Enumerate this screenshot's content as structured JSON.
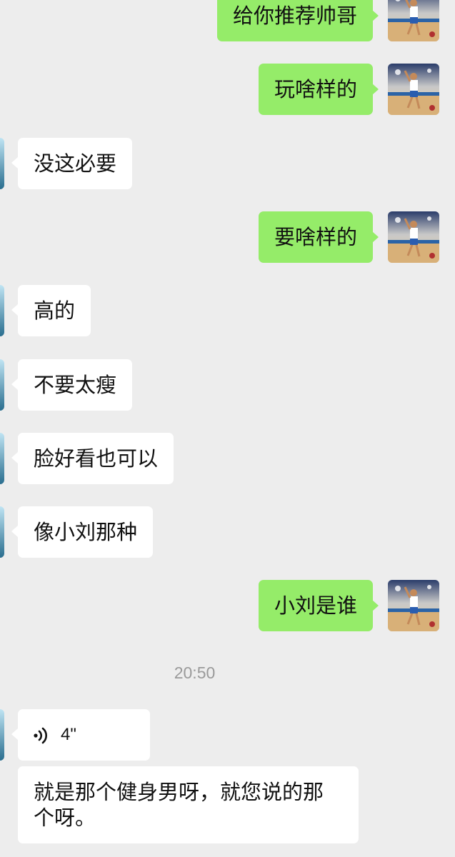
{
  "messages": [
    {
      "id": 1,
      "side": "out",
      "text": "给你推荐帅哥"
    },
    {
      "id": 2,
      "side": "out",
      "text": "玩啥样的"
    },
    {
      "id": 3,
      "side": "in",
      "text": "没这必要"
    },
    {
      "id": 4,
      "side": "out",
      "text": "要啥样的"
    },
    {
      "id": 5,
      "side": "in",
      "text": "高的"
    },
    {
      "id": 6,
      "side": "in",
      "text": "不要太瘦"
    },
    {
      "id": 7,
      "side": "in",
      "text": "脸好看也可以"
    },
    {
      "id": 8,
      "side": "in",
      "text": "像小刘那种"
    },
    {
      "id": 9,
      "side": "out",
      "text": "小刘是谁"
    },
    {
      "id": 10,
      "side": "in",
      "type": "voice",
      "duration": "4\""
    },
    {
      "id": 11,
      "side": "in",
      "text": "就是那个健身男呀，就您说的那个呀。"
    }
  ],
  "time_divider": "20:50",
  "icons": {
    "voice": "voice-wave-icon",
    "avatar_self": "basketball-player-avatar",
    "avatar_other": "contact-avatar"
  },
  "colors": {
    "background": "#ededed",
    "outgoing_bubble": "#95ec69",
    "incoming_bubble": "#ffffff",
    "timestamp": "#9a9a9a"
  }
}
